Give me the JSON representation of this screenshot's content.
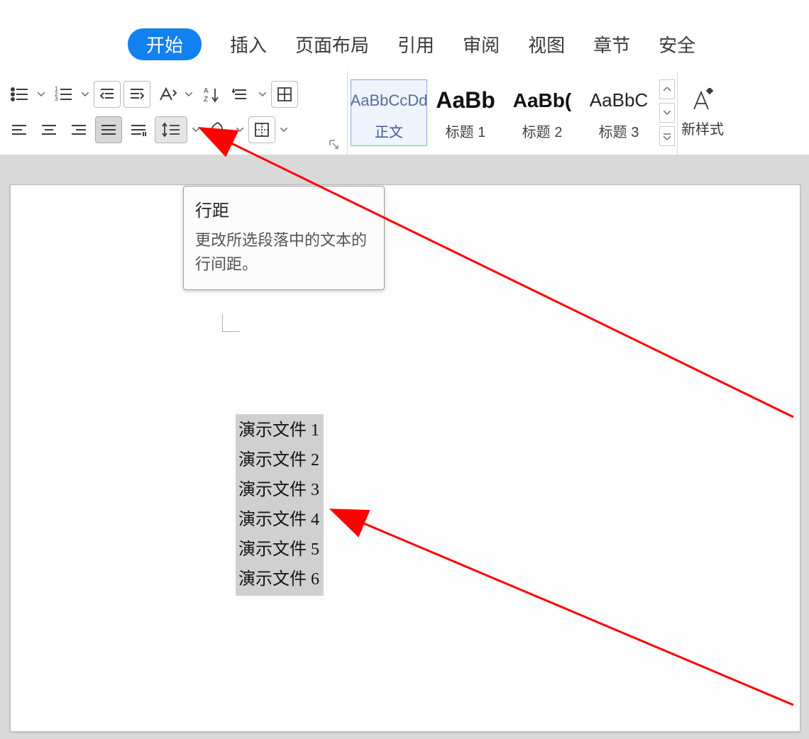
{
  "tabs": {
    "active": "开始",
    "items": [
      "开始",
      "插入",
      "页面布局",
      "引用",
      "审阅",
      "视图",
      "章节",
      "安全"
    ]
  },
  "tooltip": {
    "title": "行距",
    "desc": "更改所选段落中的文本的行间距。"
  },
  "styles": {
    "normal": {
      "preview": "AaBbCcDd",
      "label": "正文"
    },
    "heading1": {
      "preview": "AaBb",
      "label": "标题 1"
    },
    "heading2": {
      "preview": "AaBb(",
      "label": "标题 2"
    },
    "heading3": {
      "preview": "AaBbC",
      "label": "标题 3"
    }
  },
  "newstyle_label": "新样式",
  "document_lines": [
    "演示文件 1",
    "演示文件 2",
    "演示文件 3",
    "演示文件 4",
    "演示文件 5",
    "演示文件 6"
  ]
}
